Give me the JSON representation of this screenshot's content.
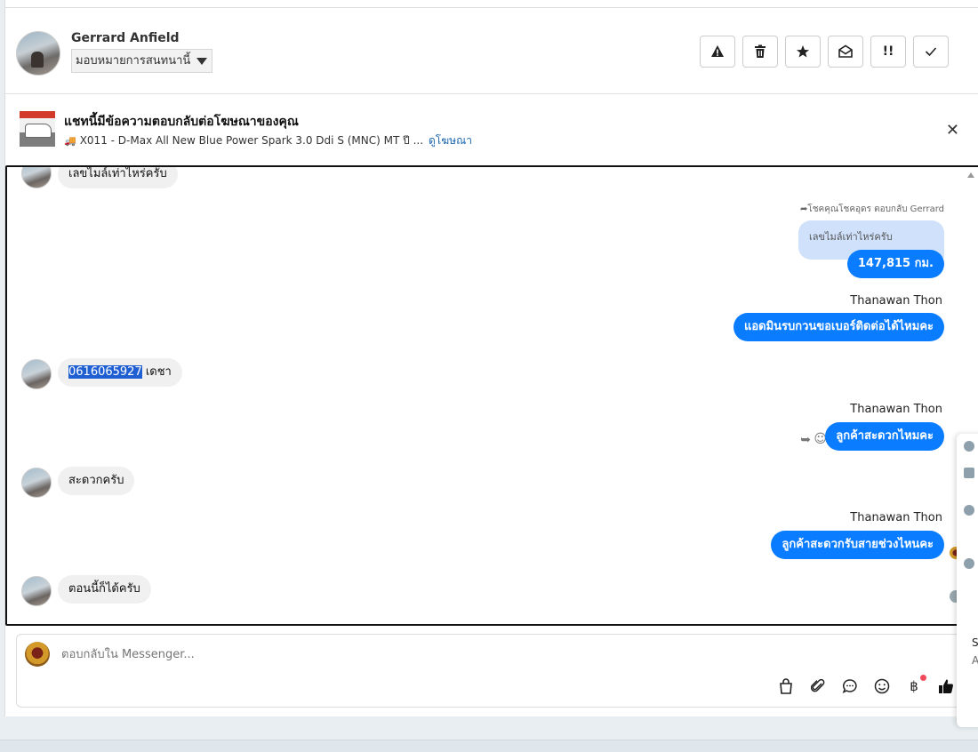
{
  "header": {
    "user_name": "Gerrard Anfield",
    "assign_label": "มอบหมายการสนทนานี้",
    "buttons": [
      "warning",
      "trash",
      "star",
      "mark-unread",
      "important",
      "done"
    ]
  },
  "banner": {
    "title": "แชทนี้มีข้อความตอบกลับต่อโฆษณาของคุณ",
    "ad_text": "X011 - D-Max All New Blue Power Spark 3.0 Ddi S (MNC) MT ปี ...",
    "view_ad_link": "ดูโฆษณา",
    "close": "✕"
  },
  "messages": {
    "m1": "เลขไมล์เท่าไหร่ครับ",
    "reply_note": "โชคคุณโชคอุดร ตอบกลับ Gerrard",
    "quoted": "เลขไมล์เท่าไหร่ครับ",
    "m2": "147,815 กม.",
    "sender1": "Thanawan Thon",
    "m3": "แอดมินรบกวนขอเบอร์ติดต่อได้ไหมคะ",
    "m4_highlight": "0616065927",
    "m4_rest": " เดชา",
    "sender2": "Thanawan Thon",
    "m5": "ลูกค้าสะดวกไหมคะ",
    "m6": "สะดวกครับ",
    "sender3": "Thanawan Thon",
    "m7": "ลูกค้าสะดวกรับสายช่วงไหนคะ",
    "m8": "ตอนนี้ก็ได้ครับ"
  },
  "composer": {
    "placeholder": "ตอบกลับใน Messenger...",
    "tools": [
      "bag-icon",
      "paperclip-icon",
      "saved-reply-icon",
      "emoji-icon",
      "baht-icon",
      "thumbs-up-icon"
    ]
  },
  "side_panel": {
    "letter1": "S",
    "letter2": "A"
  },
  "colors": {
    "outgoing": "#0a7cff",
    "incoming": "#f0f0f0",
    "quoted": "#cfe1fb",
    "link": "#1a66b0"
  }
}
